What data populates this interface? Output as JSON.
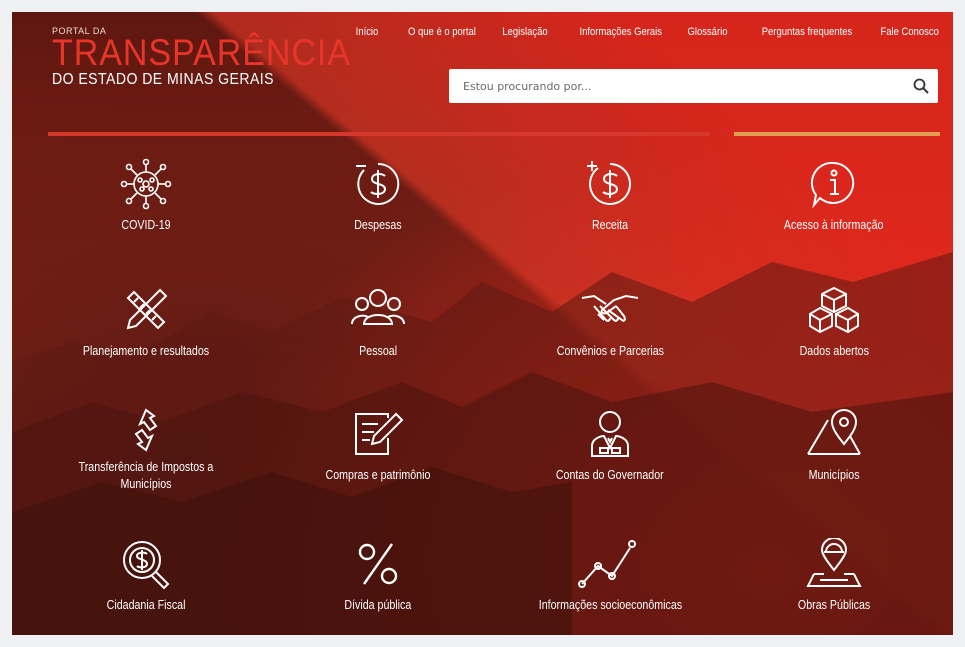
{
  "logo": {
    "small": "PORTAL DA",
    "big": "TRANSPARÊNCIA",
    "sub": "DO ESTADO DE MINAS GERAIS"
  },
  "nav": [
    {
      "label": "Início"
    },
    {
      "label": "O que é o portal"
    },
    {
      "label": "Legislação"
    },
    {
      "label": "Informações Gerais"
    },
    {
      "label": "Glossário"
    },
    {
      "label": "Perguntas frequentes"
    },
    {
      "label": "Fale Conosco"
    }
  ],
  "search": {
    "placeholder": "Estou procurando por...",
    "icon": "magnifier-icon"
  },
  "colors": {
    "accent_red": "#d6392c",
    "accent_gold": "#e0a050"
  },
  "tiles": [
    {
      "label": "COVID-19",
      "icon": "virus-icon"
    },
    {
      "label": "Despesas",
      "icon": "dollar-minus-icon"
    },
    {
      "label": "Receita",
      "icon": "dollar-plus-icon"
    },
    {
      "label": "Acesso à informação",
      "icon": "info-speech-icon"
    },
    {
      "label": "Planejamento e resultados",
      "icon": "pencil-ruler-icon"
    },
    {
      "label": "Pessoal",
      "icon": "people-icon"
    },
    {
      "label": "Convênios e Parcerias",
      "icon": "handshake-icon"
    },
    {
      "label": "Dados abertos",
      "icon": "cubes-icon"
    },
    {
      "label": "Transferência de Impostos a Municípios",
      "icon": "transfer-arrows-icon"
    },
    {
      "label": "Compras e patrimônio",
      "icon": "document-pen-icon"
    },
    {
      "label": "Contas do Governador",
      "icon": "governor-icon"
    },
    {
      "label": "Municípios",
      "icon": "map-pin-icon"
    },
    {
      "label": "Cidadania Fiscal",
      "icon": "dollar-search-icon"
    },
    {
      "label": "Dívida pública",
      "icon": "percent-icon"
    },
    {
      "label": "Informações socioeconômicas",
      "icon": "line-chart-icon"
    },
    {
      "label": "Obras Públicas",
      "icon": "hardhat-map-icon"
    }
  ]
}
